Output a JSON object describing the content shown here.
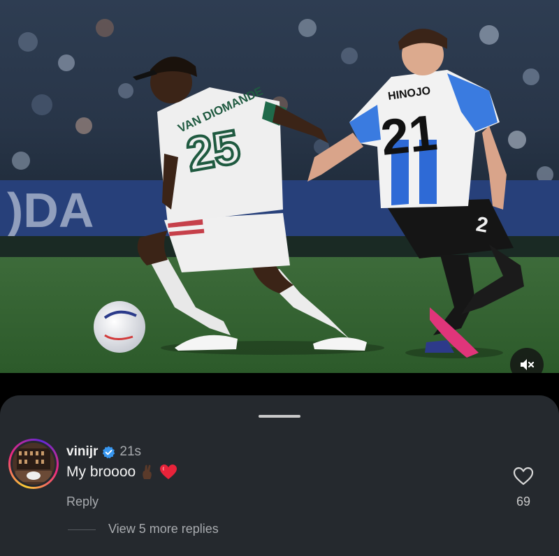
{
  "media": {
    "player_left": {
      "name": "VAN DIOMANDE",
      "number": "25"
    },
    "player_right": {
      "name": "HINOJO",
      "number": "21",
      "short_number": "2"
    },
    "mute_icon": "speaker-muted-icon"
  },
  "comment": {
    "username": "vinijr",
    "verified_icon": "verified-badge-icon",
    "time": "21s",
    "text": "My broooo",
    "emojis": [
      "crossed-fingers-dark-skin-emoji",
      "red-heart-emoji"
    ],
    "reply_label": "Reply",
    "like_icon": "heart-outline-icon",
    "like_count": "69",
    "view_replies_label": "View 5 more replies"
  },
  "colors": {
    "sheet_bg": "#25292e",
    "verified_blue": "#3897f0",
    "heart_red": "#e8233a",
    "muted_text": "#a8abaf"
  }
}
